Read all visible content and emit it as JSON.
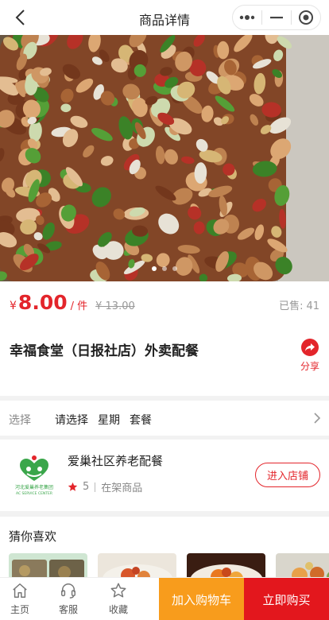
{
  "navbar": {
    "title": "商品详情",
    "back_icon": "chevron-left-icon",
    "capsule_icons": [
      "more-dots-icon",
      "minimize-icon",
      "target-icon"
    ]
  },
  "hero": {
    "slide_count": 3,
    "active_slide": 1
  },
  "product": {
    "currency": "¥",
    "price": "8.00",
    "unit": "/ 件",
    "original_price": "¥ 13.00",
    "sold_label": "已售:",
    "sold_count": "41",
    "title": "幸福食堂（日报社店）外卖配餐",
    "share_label": "分享"
  },
  "selection": {
    "label": "选择",
    "values": [
      "请选择",
      "星期",
      "套餐"
    ]
  },
  "shop": {
    "name": "爱巢社区养老配餐",
    "rating": "5",
    "goods_label": "在架商品",
    "enter_label": "进入店铺",
    "logo_text_cn": "河北爱巢养老集团",
    "logo_text_en": "AC SERVICE CENTER"
  },
  "guess": {
    "title": "猜你喜欢"
  },
  "bottom_bar": {
    "tabs": [
      {
        "label": "主页",
        "icon": "home-icon"
      },
      {
        "label": "客服",
        "icon": "headset-icon"
      },
      {
        "label": "收藏",
        "icon": "star-icon"
      }
    ],
    "add_to_cart": "加入购物车",
    "buy_now": "立即购买"
  },
  "colors": {
    "accent_red": "#e3252b",
    "cart_orange": "#f89c1c",
    "buy_red": "#e3171d"
  }
}
